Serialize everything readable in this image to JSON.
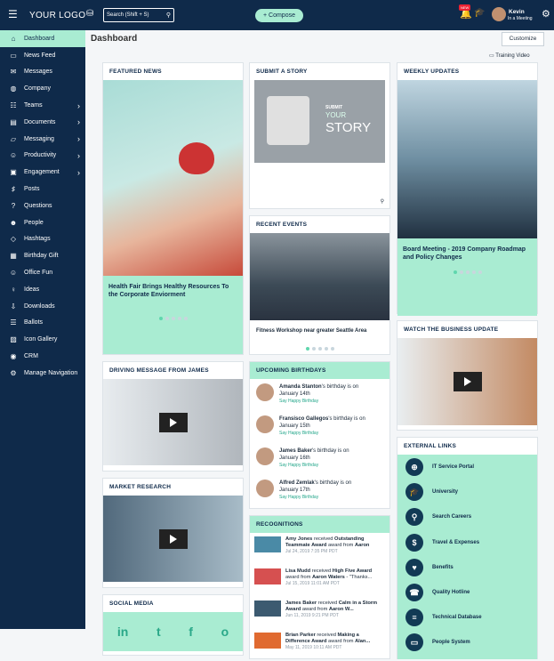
{
  "topbar": {
    "logo": "YOUR LOGO",
    "search_placeholder": "Search (Shift + S)",
    "compose": "+ Compose",
    "badge": "NEW",
    "user_name": "Kevin",
    "user_status": "In a Meeting"
  },
  "sidebar": {
    "items": [
      {
        "label": "Dashboard",
        "icon": "home-icon",
        "active": true
      },
      {
        "label": "News Feed",
        "icon": "news-feed-icon"
      },
      {
        "label": "Messages",
        "icon": "mail-icon"
      },
      {
        "label": "Company",
        "icon": "globe-icon"
      },
      {
        "label": "Teams",
        "icon": "team-icon",
        "chev": true
      },
      {
        "label": "Documents",
        "icon": "document-icon",
        "chev": true
      },
      {
        "label": "Messaging",
        "icon": "messaging-icon",
        "chev": true
      },
      {
        "label": "Productivity",
        "icon": "productivity-icon",
        "chev": true
      },
      {
        "label": "Engagement",
        "icon": "engagement-icon",
        "chev": true
      },
      {
        "label": "Posts",
        "icon": "posts-icon"
      },
      {
        "label": "Questions",
        "icon": "question-icon"
      },
      {
        "label": "People",
        "icon": "people-icon"
      },
      {
        "label": "Hashtags",
        "icon": "tag-icon"
      },
      {
        "label": "Birthday Gift",
        "icon": "gift-icon"
      },
      {
        "label": "Office Fun",
        "icon": "smile-icon"
      },
      {
        "label": "Ideas",
        "icon": "bulb-icon"
      },
      {
        "label": "Downloads",
        "icon": "download-icon"
      },
      {
        "label": "Ballots",
        "icon": "ballot-icon"
      },
      {
        "label": "Icon Gallery",
        "icon": "gallery-icon"
      },
      {
        "label": "CRM",
        "icon": "crm-icon"
      },
      {
        "label": "Manage Navigation",
        "icon": "gear-icon"
      }
    ]
  },
  "header": {
    "title": "Dashboard",
    "customize": "Customize",
    "training": "Training Video"
  },
  "featured": {
    "title": "FEATURED NEWS",
    "caption": "Health Fair Brings Healthy Resources To the Corporate Enviorment"
  },
  "submit": {
    "title": "SUBMIT A STORY",
    "img_small": "SUBMIT",
    "img_your": "YOUR",
    "img_big": "STORY"
  },
  "events": {
    "title": "RECENT EVENTS",
    "caption": "Fitness Workshop near greater Seattle Area"
  },
  "weekly": {
    "title": "WEEKLY UPDATES",
    "caption": "Board Meeting - 2019 Company Roadmap and Policy Changes"
  },
  "driving": {
    "title": "DRIVING MESSAGE FROM JAMES"
  },
  "market": {
    "title": "MARKET RESEARCH"
  },
  "social": {
    "title": "SOCIAL MEDIA",
    "icons": [
      "in",
      "t",
      "f",
      "o"
    ]
  },
  "birthdays": {
    "title": "UPCOMING BIRTHDAYS",
    "link": "Say Happy Birthday",
    "items": [
      {
        "name": "Amanda Stanton",
        "text": "'s birthday is on",
        "date": "January 14th"
      },
      {
        "name": "Fransisco Gallegos",
        "text": "'s birthday is on",
        "date": "January 15th"
      },
      {
        "name": "James Baker",
        "text": "'s birthday is on",
        "date": "January 16th"
      },
      {
        "name": "Alfred Zemlak",
        "text": "'s birthday is on",
        "date": "January 17th"
      }
    ]
  },
  "recognitions": {
    "title": "RECOGNITIONS",
    "items": [
      {
        "a": "Amy Jones",
        "b": " received ",
        "c": "Outstanding Teammate Award",
        "d": " award from ",
        "e": "Aaron",
        "date": "Jul 24, 2019 7:35 PM PDT"
      },
      {
        "a": "Lisa Mudd",
        "b": " received ",
        "c": "High Five Award",
        "d": " award from ",
        "e": "Aaron Waters",
        "f": " - \"Thanks...",
        "date": "Jul 15, 2019 11:01 AM PDT"
      },
      {
        "a": "James Baker",
        "b": " received ",
        "c": "Calm in a Storm Award",
        "d": " award from ",
        "e": "Aaron W...",
        "date": "Jun 11, 2019 9:21 PM PDT"
      },
      {
        "a": "Brian Parker",
        "b": " received ",
        "c": "Making a Difference Award",
        "d": " award from ",
        "e": "Alan...",
        "date": "May 11, 2019 10:11 AM PDT"
      }
    ]
  },
  "watch": {
    "title": "WATCH THE BUSINESS UPDATE"
  },
  "external": {
    "title": "EXTERNAL LINKS",
    "items": [
      {
        "label": "IT Service Portal",
        "icon": "globe-icon",
        "g": "⊕"
      },
      {
        "label": "University",
        "icon": "graduation-cap-icon",
        "g": "🎓"
      },
      {
        "label": "Search Careers",
        "icon": "search-icon",
        "g": "⚲"
      },
      {
        "label": "Travel & Expenses",
        "icon": "dollar-icon",
        "g": "$"
      },
      {
        "label": "Benefits",
        "icon": "heartbeat-icon",
        "g": "♥"
      },
      {
        "label": "Quality Hotline",
        "icon": "phone-icon",
        "g": "☎"
      },
      {
        "label": "Technical Database",
        "icon": "database-icon",
        "g": "≡"
      },
      {
        "label": "People System",
        "icon": "monitor-icon",
        "g": "▭"
      }
    ]
  }
}
